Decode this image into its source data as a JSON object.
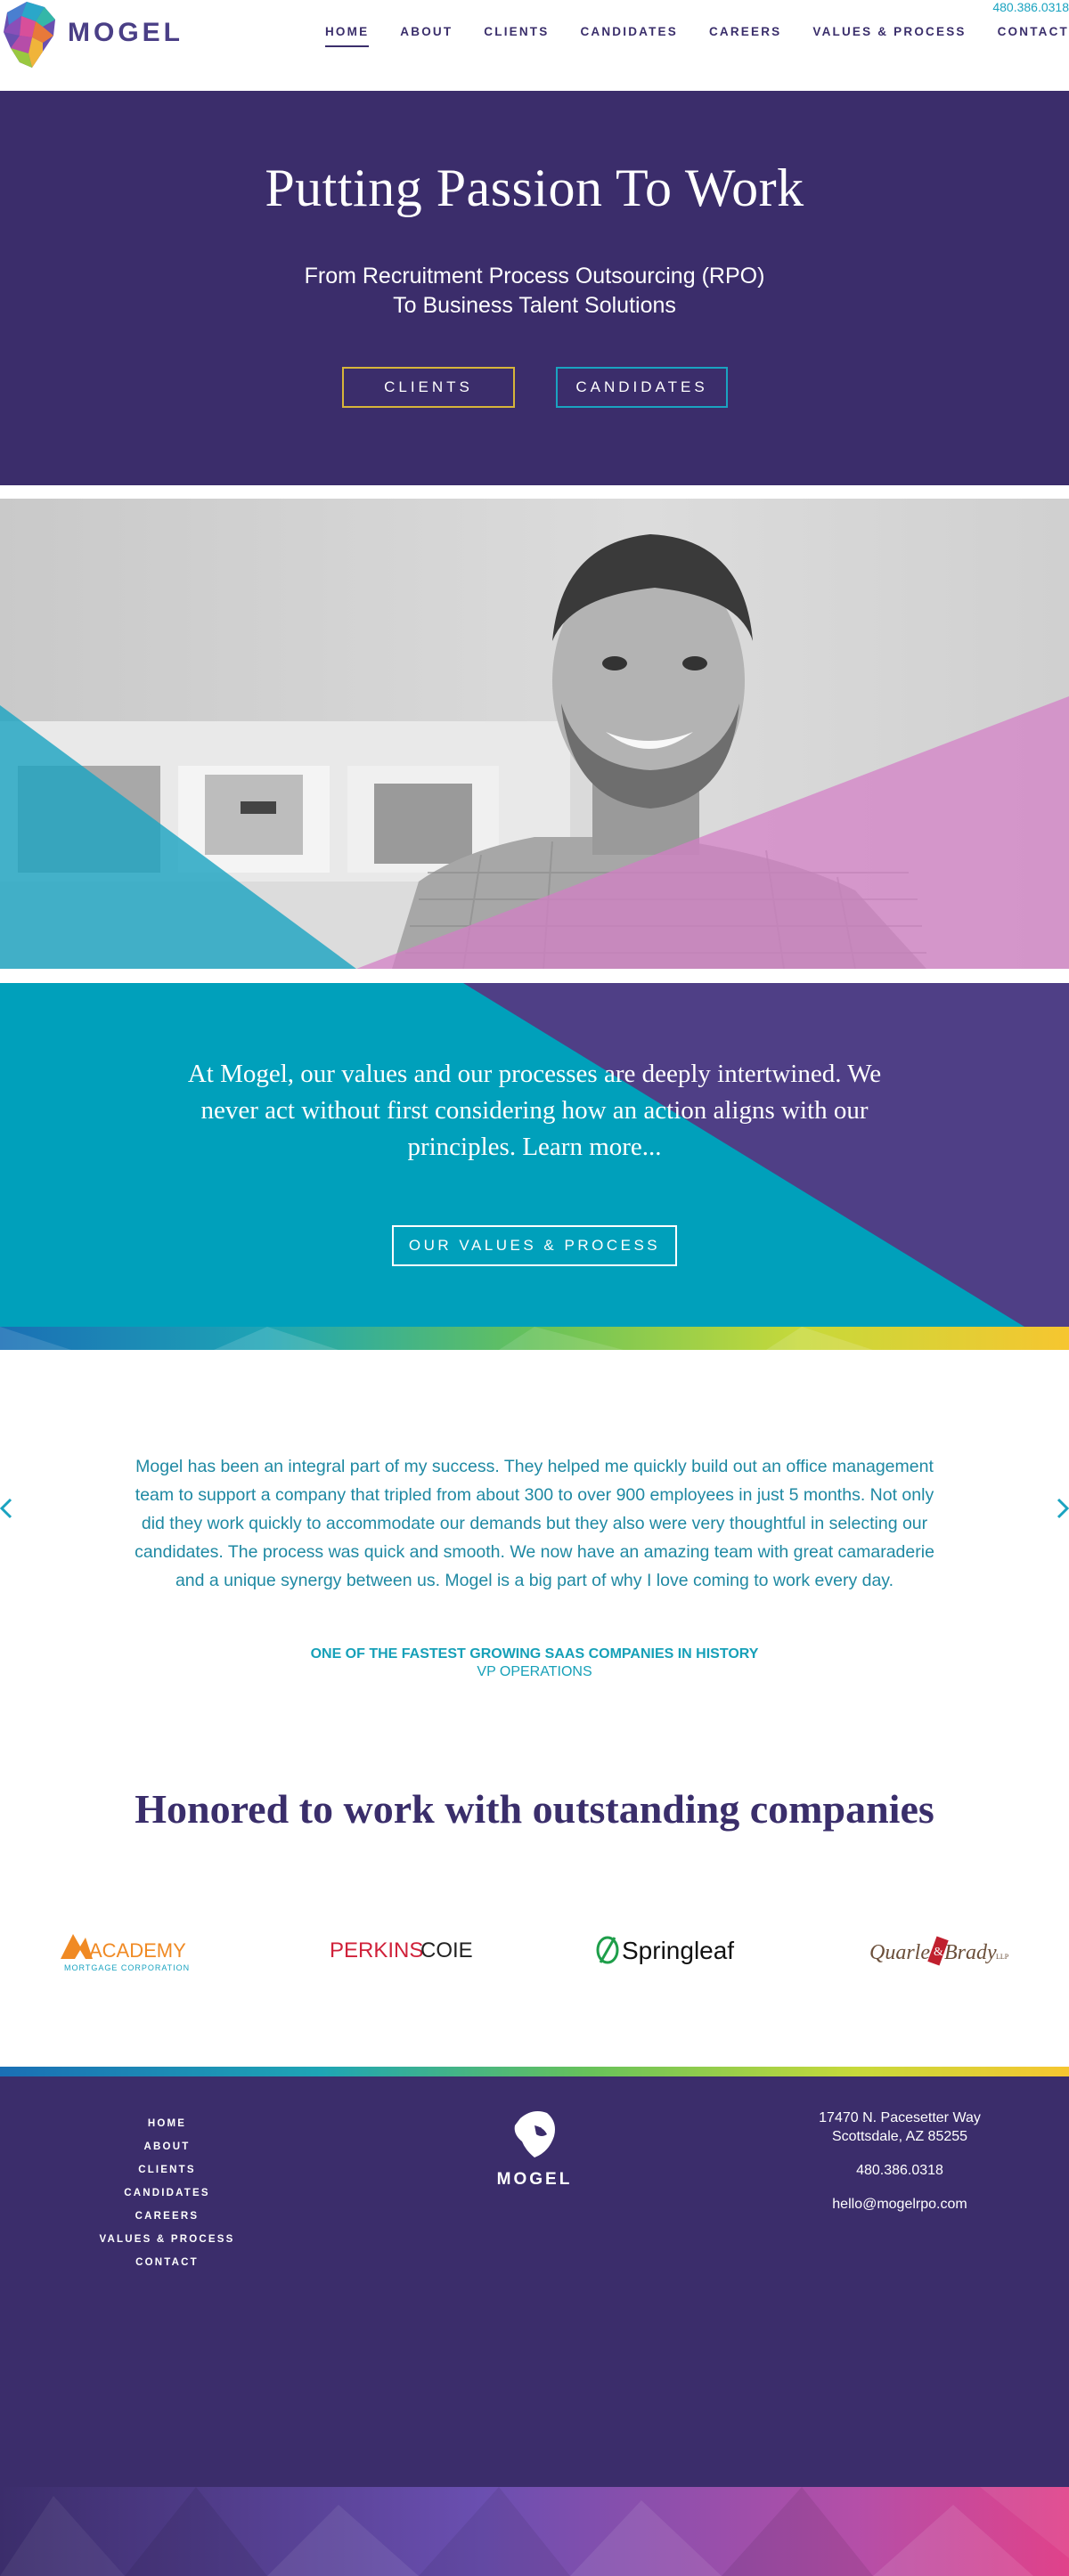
{
  "header": {
    "phone": "480.386.0318",
    "logo_text": "MOGEL",
    "nav": [
      {
        "label": "HOME",
        "active": true
      },
      {
        "label": "ABOUT"
      },
      {
        "label": "CLIENTS"
      },
      {
        "label": "CANDIDATES"
      },
      {
        "label": "CAREERS"
      },
      {
        "label": "VALUES & PROCESS"
      },
      {
        "label": "CONTACT"
      }
    ]
  },
  "hero": {
    "title": "Putting Passion To Work",
    "subtitle_line1": "From Recruitment Process Outsourcing (RPO)",
    "subtitle_line2": "To Business Talent Solutions",
    "btn_clients": "CLIENTS",
    "btn_candidates": "CANDIDATES"
  },
  "values": {
    "text": "At Mogel, our values and our processes are deeply intertwined. We never act without first considering how an action aligns with our principles. Learn more...",
    "button": "OUR VALUES & PROCESS"
  },
  "testimonial": {
    "quote": "Mogel has been an integral part of my success. They helped me quickly build out an office management team to support a company that tripled from about 300 to over 900 employees in just 5 months. Not only did they work quickly to accommodate our demands but they also were very thoughtful in selecting our candidates. The process was quick and smooth. We now have an amazing team with great camaraderie and a unique synergy between us. Mogel is a big part of why I love coming to work every day.",
    "company": "ONE OF THE FASTEST GROWING SAAS COMPANIES IN HISTORY",
    "role": "VP OPERATIONS"
  },
  "companies": {
    "heading": "Honored to work with outstanding companies",
    "academy": {
      "name": "ACADEMY",
      "sub": "MORTGAGE CORPORATION"
    },
    "perkins": {
      "part1": "PERKINS",
      "part2": "COIE"
    },
    "springleaf": "Springleaf",
    "quarles": {
      "part1": "Quarles",
      "amp": "&",
      "part2": "Brady",
      "suffix": "LLP"
    }
  },
  "footer": {
    "nav": [
      "HOME",
      "ABOUT",
      "CLIENTS",
      "CANDIDATES",
      "CAREERS",
      "VALUES & PROCESS",
      "CONTACT"
    ],
    "logo_text": "MOGEL",
    "address1": "17470 N. Pacesetter Way",
    "address2": "Scottsdale, AZ 85255",
    "phone": "480.386.0318",
    "email": "hello@mogelrpo.com"
  },
  "colors": {
    "purple": "#3b2d6b",
    "teal": "#00a0bb",
    "gold": "#d7b53a",
    "accent_blue": "#1aa3c0"
  }
}
